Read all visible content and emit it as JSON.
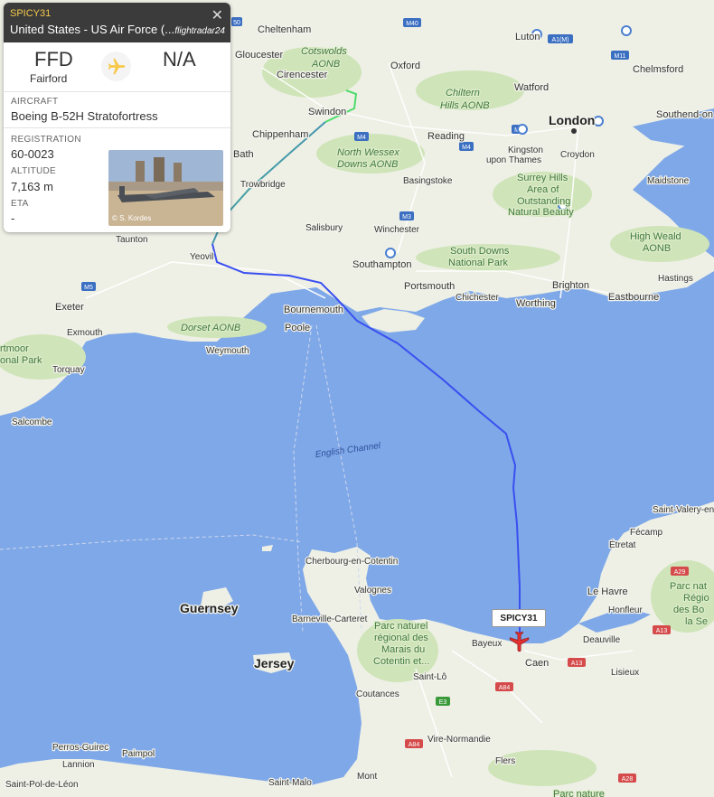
{
  "flight": {
    "callsign": "SPICY31",
    "operator": "United States - US Air Force (...",
    "provider_logo": "flightradar24",
    "origin_code": "FFD",
    "origin_name": "Fairford",
    "dest_code": "N/A",
    "aircraft_label": "AIRCRAFT",
    "aircraft": "Boeing B-52H Stratofortress",
    "registration_label": "REGISTRATION",
    "registration": "60-0023",
    "altitude_label": "ALTITUDE",
    "altitude": "7,163 m",
    "eta_label": "ETA",
    "eta": "-",
    "photo_credit": "© S. Kordes",
    "tag": "SPICY31"
  },
  "places": {
    "cheltenham": "Cheltenham",
    "gloucester": "Gloucester",
    "cotswolds": "Cotswolds",
    "aonb": "AONB",
    "cirencester": "Cirencester",
    "oxford": "Oxford",
    "luton": "Luton",
    "chelmsford": "Chelmsford",
    "watford": "Watford",
    "chiltern": "Chiltern",
    "chiltern2": "Hills AONB",
    "london": "London",
    "southend": "Southend-on",
    "swindon": "Swindon",
    "chippenham": "Chippenham",
    "reading": "Reading",
    "kingston": "Kingston",
    "kingston2": "upon Thames",
    "croydon": "Croydon",
    "bath": "Bath",
    "northwessex": "North Wessex",
    "northwessex2": "Downs AONB",
    "basingstoke": "Basingstoke",
    "surrey1": "Surrey Hills",
    "surrey2": "Area of",
    "surrey3": "Outstanding",
    "surrey4": "Natural Beauty",
    "maidstone": "Maidstone",
    "trowbridge": "Trowbridge",
    "winchester": "Winchester",
    "salisbury": "Salisbury",
    "highweald": "High Weald",
    "highweald2": "AONB",
    "taunton": "Taunton",
    "southdowns": "South Downs",
    "southdowns2": "National Park",
    "yeovil": "Yeovil",
    "southampton": "Southampton",
    "hastings": "Hastings",
    "portsmouth": "Portsmouth",
    "brighton": "Brighton",
    "chichester": "Chichester",
    "worthing": "Worthing",
    "eastbourne": "Eastbourne",
    "exeter": "Exeter",
    "bournemouth": "Bournemouth",
    "poole": "Poole",
    "exmouth": "Exmouth",
    "dorset": "Dorset AONB",
    "weymouth": "Weymouth",
    "dartmoor1": "rtmoor",
    "dartmoor2": "onal Park",
    "torquay": "Torquay",
    "salcombe": "Salcombe",
    "channel": "English Channel",
    "saintvalery": "Saint-Valery-en-",
    "fecamp": "Fécamp",
    "etretat": "Étretat",
    "cherbourg": "Cherbourg-en-Cotentin",
    "a29": "A29",
    "valognes": "Valognes",
    "guernsey": "Guernsey",
    "lehavre": "Le Havre",
    "parcnat1": "Parc nat",
    "parcnat2": "Régio",
    "parcnat3": "des Bo",
    "parcnat4": "la Se",
    "honfleur": "Honfleur",
    "barneville": "Barneville-Carteret",
    "parcmarais1": "Parc naturel",
    "parcmarais2": "régional des",
    "parcmarais3": "Marais du",
    "parcmarais4": "Cotentin et...",
    "bayeux": "Bayeux",
    "deauville": "Deauville",
    "jersey": "Jersey",
    "caen": "Caen",
    "lisieux": "Lisieux",
    "saintlo": "Saint-Lô",
    "coutances": "Coutances",
    "perros": "Perros-Guirec",
    "paimpol": "Paimpol",
    "vire": "Vire-Normandie",
    "lannion": "Lannion",
    "flers": "Flers",
    "saintpol": "Saint-Pol-de-Léon",
    "saintmalo": "Saint-Malo",
    "mont": "Mont",
    "parcnormandie": "Parc nature"
  },
  "roads": {
    "m40": "M40",
    "a1m": "A1(M)",
    "m11": "M11",
    "m4a": "M4",
    "m4b": "M4",
    "m4c": "M4",
    "m3": "M3",
    "m5": "M5",
    "m50": "50",
    "a13a": "A13",
    "a13b": "A13",
    "a84a": "A84",
    "a84b": "A84",
    "e3": "E3",
    "a28": "A28",
    "a29b": "A29"
  },
  "colors": {
    "sea": "#7fa8e8",
    "land": "#eef0e6",
    "green": "#cfe4b8",
    "track_blue": "#3a4ff0",
    "track_green": "#4ddc6b",
    "aircraft": "#e03030",
    "accent": "#f7c94b"
  }
}
